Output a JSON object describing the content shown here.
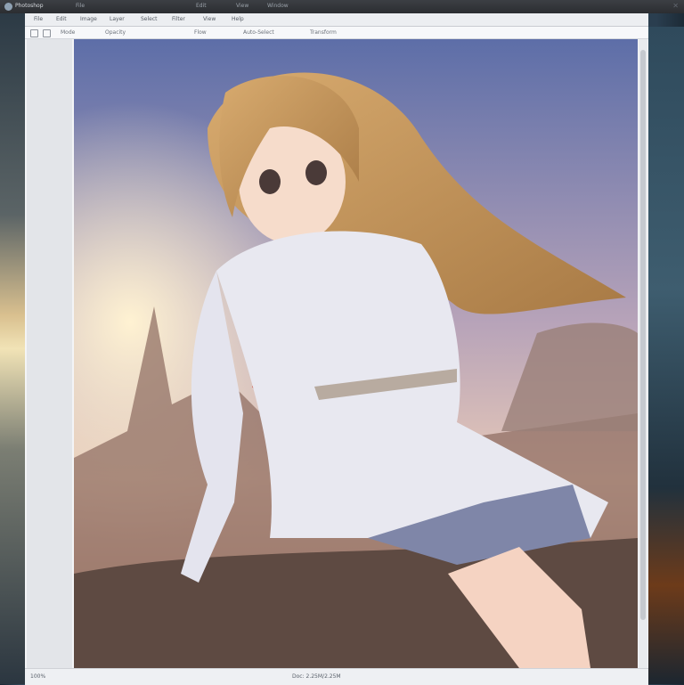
{
  "app": {
    "title": "Photoshop",
    "title_segments": [
      "File",
      "Edit",
      "View",
      "Window"
    ]
  },
  "menubar": {
    "items": [
      "File",
      "Edit",
      "Image",
      "Layer",
      "Select",
      "Filter",
      "View",
      "Help"
    ]
  },
  "toolbar": {
    "labels": [
      "Mode",
      "Opacity",
      "Flow",
      "Auto-Select",
      "Transform"
    ]
  },
  "status": {
    "left": "100%",
    "right": "Doc: 2.25M/2.25M"
  },
  "colors": {
    "sky_top": "#5d6ea8",
    "sky_mid": "#b7a3b9",
    "sun": "#fff2d2",
    "hair": "#c9985c",
    "dress": "#e8e8f0",
    "cape": "#d23a2a"
  },
  "icons": [
    "app-icon",
    "close-icon",
    "tool-icon"
  ]
}
